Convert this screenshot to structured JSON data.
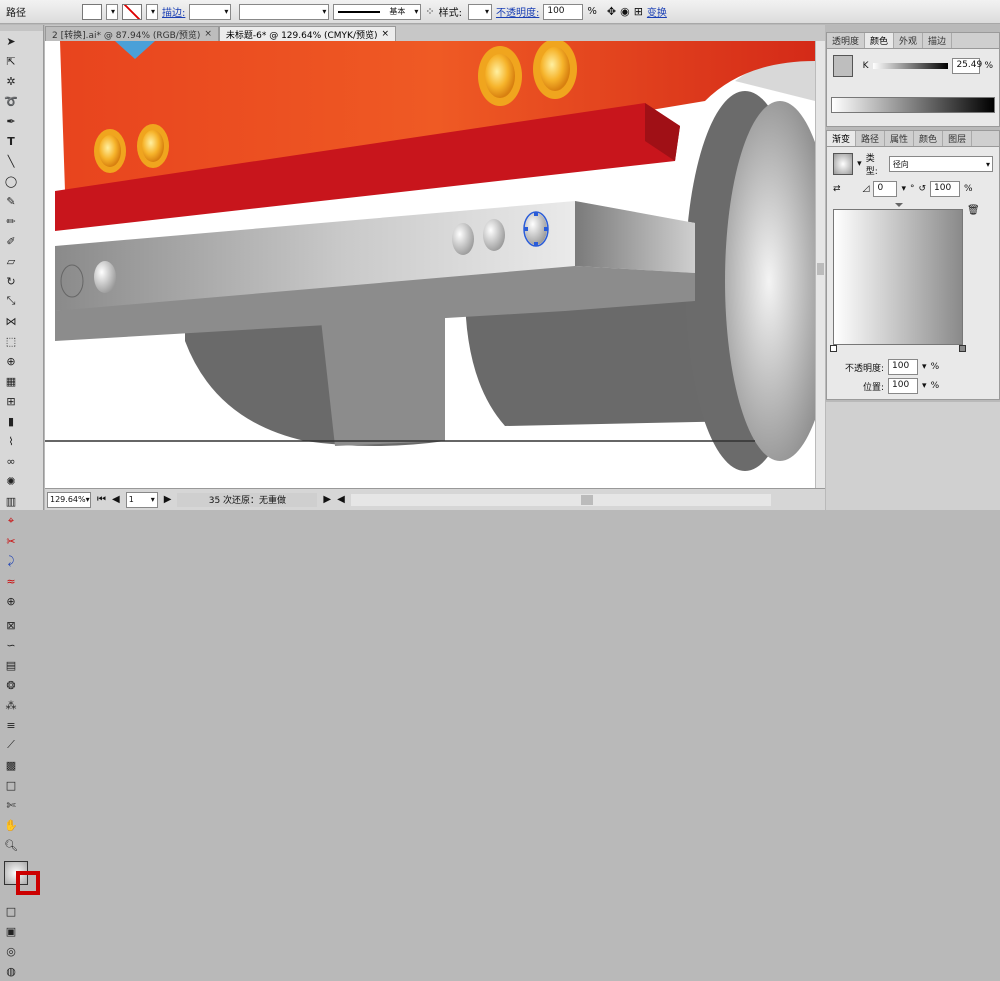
{
  "control_bar": {
    "object_type": "路径",
    "stroke_label": "描边:",
    "stroke_style": "基本",
    "style_label": "样式:",
    "opacity_label": "不透明度:",
    "opacity_value": "100",
    "opacity_unit": "%",
    "transform_label": "变换"
  },
  "doc_tabs": [
    {
      "label": "2 [转换].ai* @ 87.94% (RGB/预览)",
      "close": "×"
    },
    {
      "label": "未标题-6* @ 129.64% (CMYK/预览)",
      "close": "×"
    }
  ],
  "status_bar": {
    "zoom": "129.64%",
    "page": "1",
    "message": "35 次还原：无重做"
  },
  "color_panel": {
    "tabs": [
      "透明度",
      "颜色",
      "外观",
      "描边"
    ],
    "channel": "K",
    "value": "25.49",
    "unit": "%"
  },
  "gradient_panel": {
    "tabs": [
      "渐变",
      "路径",
      "属性",
      "颜色",
      "图层"
    ],
    "type_label": "类型:",
    "type_value": "径向",
    "angle_value": "0",
    "angle_unit": "°",
    "aspect_value": "100",
    "aspect_unit": "%",
    "opacity_label": "不透明度:",
    "opacity_value": "100",
    "opacity_unit": "%",
    "location_label": "位置:",
    "location_value": "100",
    "location_unit": "%"
  },
  "colors": {
    "car_red": "#e8441e",
    "bumper_red": "#c8151c",
    "bumper_gray": "#8c8c8c",
    "wheel_gray": "#6a6a6a",
    "lamp_orange": "#f0a51e",
    "selection_blue": "#2a5cd8"
  }
}
